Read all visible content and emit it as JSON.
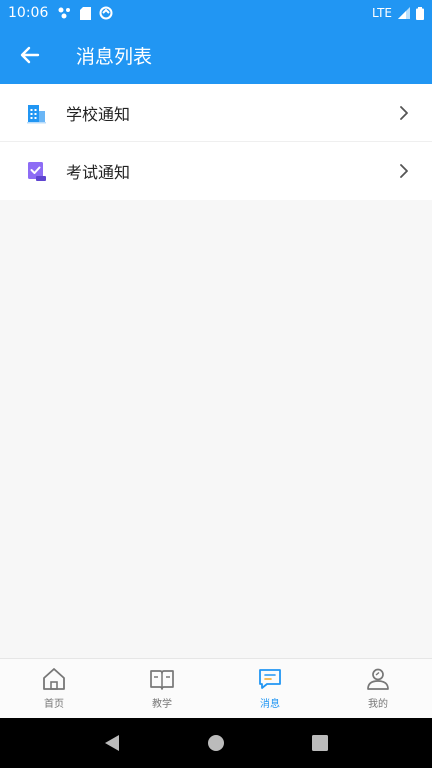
{
  "status_bar": {
    "time": "10:06",
    "network": "LTE"
  },
  "app_bar": {
    "title": "消息列表"
  },
  "list": {
    "items": [
      {
        "label": "学校通知",
        "icon": "school-building-icon"
      },
      {
        "label": "考试通知",
        "icon": "exam-check-icon"
      }
    ]
  },
  "bottom_nav": {
    "items": [
      {
        "label": "首页",
        "icon": "home-icon"
      },
      {
        "label": "教学",
        "icon": "book-icon"
      },
      {
        "label": "消息",
        "icon": "message-icon",
        "active": true
      },
      {
        "label": "我的",
        "icon": "profile-icon"
      }
    ]
  },
  "colors": {
    "primary": "#2196f3",
    "inactive": "#777777",
    "exam_purple": "#7b5cf0"
  }
}
